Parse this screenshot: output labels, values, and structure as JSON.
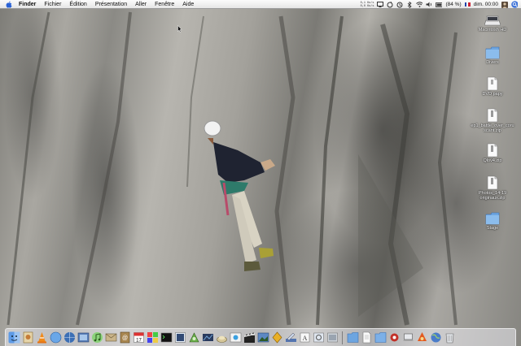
{
  "menubar": {
    "apple_icon": "apple-icon",
    "items": [
      {
        "label": "Finder",
        "bold": true
      },
      {
        "label": "Fichier"
      },
      {
        "label": "Édition"
      },
      {
        "label": "Présentation"
      },
      {
        "label": "Aller"
      },
      {
        "label": "Fenêtre"
      },
      {
        "label": "Aide"
      }
    ],
    "status": {
      "net_up": "0,1 Ko/s",
      "net_down": "0,0 Ko/s",
      "battery": "(84 %)",
      "clock": "dim. 00:00"
    }
  },
  "desktop_icons": [
    {
      "name": "macintosh-hd-icon",
      "label": "Macintosh HD"
    },
    {
      "name": "folder-icon",
      "label": "Divers"
    },
    {
      "name": "document-icon",
      "label": "DVD papy"
    },
    {
      "name": "zip-file-icon",
      "label": "ep1_battle_over_coru scant.zip"
    },
    {
      "name": "zip-file-icon",
      "label": "Qlov4.zip"
    },
    {
      "name": "zip-file-icon",
      "label": "Photos_14-19 originaux.zip"
    },
    {
      "name": "folder-icon",
      "label": "Stage"
    }
  ],
  "dock": {
    "items": [
      "finder-icon",
      "preview-icon",
      "vlc-icon",
      "safari-icon",
      "network-icon",
      "iphoto-icon",
      "itunes-icon",
      "mail-icon",
      "address-book-icon",
      "ical-icon",
      "color-icon",
      "terminal-icon",
      "camino-icon",
      "widget-icon",
      "paint-icon",
      "archive-icon",
      "imovie-icon",
      "clapper-icon",
      "photo-icon",
      "app-icon",
      "tool-icon",
      "dictionary-icon",
      "system-prefs-icon",
      "sync-icon",
      "sep",
      "folder-icon",
      "document-icon",
      "folder-icon",
      "red-app-icon",
      "laptop-icon",
      "mozilla-icon",
      "globe-icon",
      "trash-icon"
    ]
  },
  "colors": {
    "menubar_bg": "#f2f2f2",
    "folder_blue": "#7fb3e6",
    "label_text": "#ffffff"
  }
}
